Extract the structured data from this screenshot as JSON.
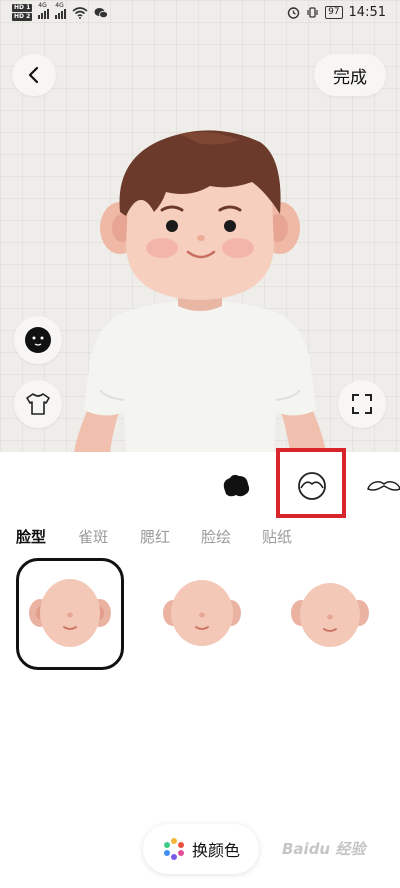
{
  "status_bar": {
    "hd1": "HD 1",
    "hd2": "HD 2",
    "net1": "4G",
    "net2": "4G",
    "battery": "97",
    "time": "14:51"
  },
  "header": {
    "back_icon": "chevron-left-icon",
    "done_label": "完成"
  },
  "side_controls": {
    "face_icon": "face-icon",
    "clothing_icon": "tshirt-icon",
    "fullscreen_icon": "fullscreen-icon"
  },
  "categories": [
    {
      "icon": "hair-icon"
    },
    {
      "icon": "face-shape-icon",
      "highlighted": true
    },
    {
      "icon": "mustache-icon"
    }
  ],
  "tabs": [
    {
      "label": "脸型",
      "active": true
    },
    {
      "label": "雀斑"
    },
    {
      "label": "腮红"
    },
    {
      "label": "脸绘"
    },
    {
      "label": "贴纸"
    }
  ],
  "face_options": [
    {
      "selected": true
    },
    {
      "selected": false
    },
    {
      "selected": false
    }
  ],
  "color_button": {
    "label": "换颜色",
    "icon": "palette-icon"
  },
  "watermark": "Baidu 经验",
  "colors": {
    "highlight": "#d8252b",
    "skin": "#f2c6b4",
    "hair": "#6b3a2a"
  }
}
